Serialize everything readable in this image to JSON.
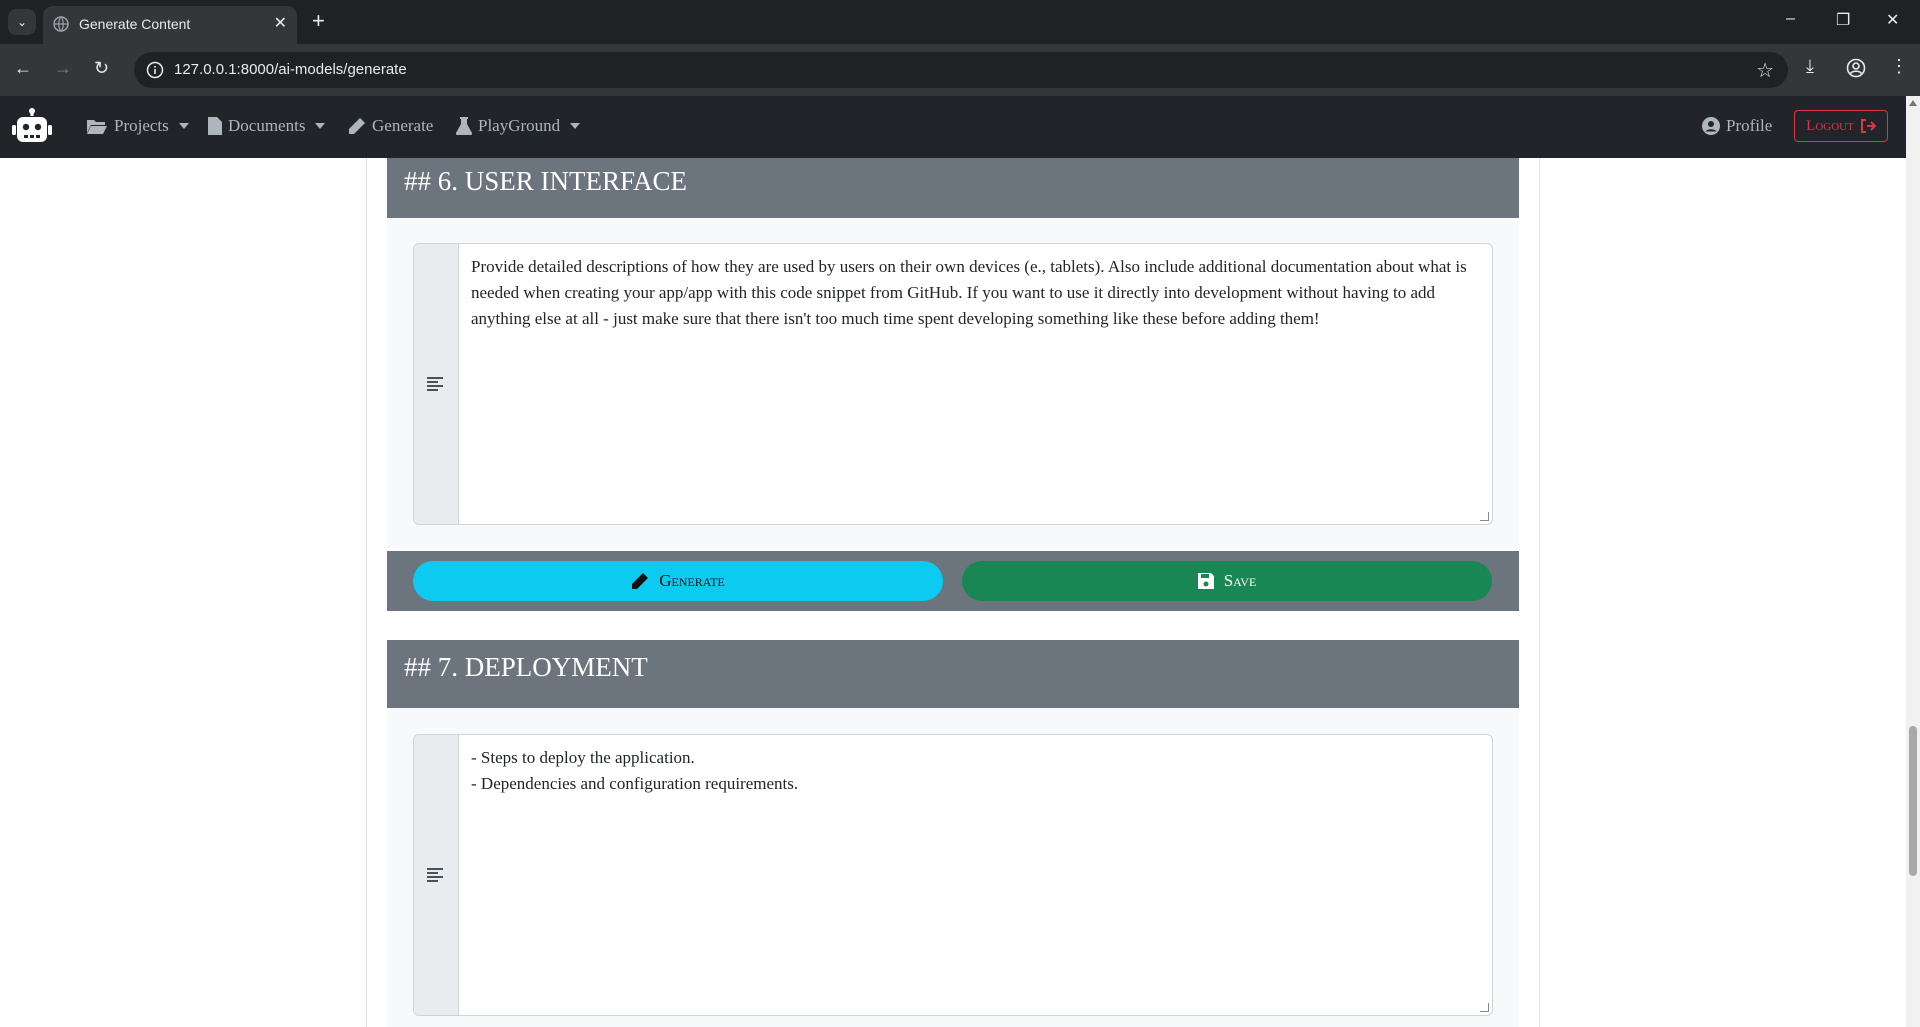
{
  "browser": {
    "tab_title": "Generate Content",
    "url": "127.0.0.1:8000/ai-models/generate"
  },
  "navbar": {
    "items": [
      {
        "label": "Projects",
        "icon": "folder-icon",
        "dropdown": true
      },
      {
        "label": "Documents",
        "icon": "document-icon",
        "dropdown": true
      },
      {
        "label": "Generate",
        "icon": "pencil-icon",
        "dropdown": false
      },
      {
        "label": "PlayGround",
        "icon": "flask-icon",
        "dropdown": true
      }
    ],
    "profile_label": "Profile",
    "logout_label": "Logout"
  },
  "sections": [
    {
      "title": "## 6. USER INTERFACE",
      "text": "Provide detailed descriptions of how they are used by users on their own devices (e., tablets). Also include additional documentation about what is needed when creating your app/app with this code snippet from GitHub. If you want to use it directly into development without having to add anything else at all - just make sure that there isn't too much time spent developing something like these before adding them!",
      "generate_label": "Generate",
      "save_label": "Save"
    },
    {
      "title": "## 7. DEPLOYMENT",
      "text": "- Steps to deploy the application.\n- Dependencies and configuration requirements."
    }
  ],
  "colors": {
    "navbar_bg": "#212529",
    "section_header_bg": "#6c757d",
    "generate_btn": "#0dcaf0",
    "save_btn": "#198754",
    "logout": "#dc3545"
  }
}
